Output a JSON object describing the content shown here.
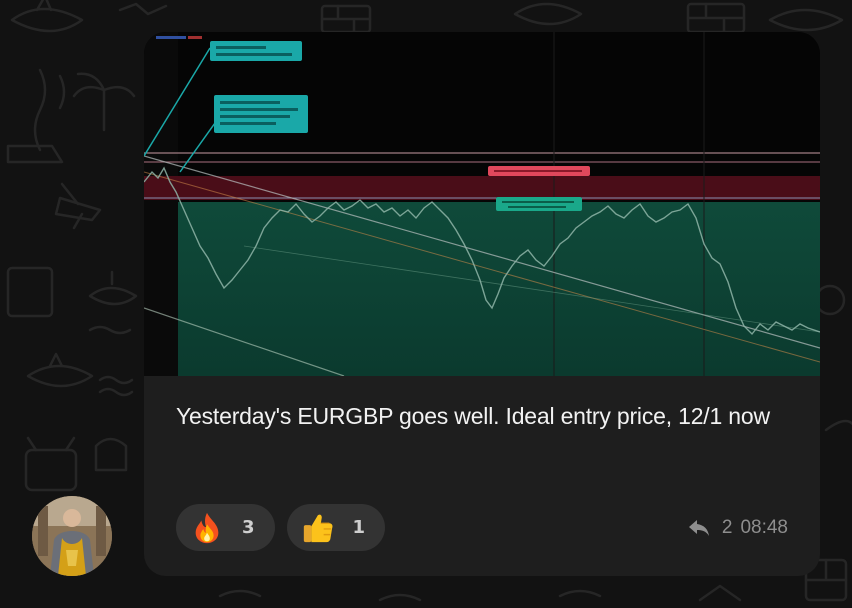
{
  "message": {
    "caption": "Yesterday's EURGBP goes well. Ideal entry price, 12/1 now",
    "reactions": [
      {
        "emoji_icon": "fire-icon",
        "count": "3"
      },
      {
        "emoji_icon": "thumbs-up-icon",
        "count": "1"
      }
    ],
    "reply_icon": "reply-arrow-icon",
    "reply_count": "2",
    "time": "08:48"
  },
  "colors": {
    "background": "#121212",
    "bubble": "#1e1e1e",
    "reaction_pill": "#333333",
    "chart_background": "#050505",
    "chart_zone_green": "#0d3d30",
    "chart_zone_red": "#4a0d18",
    "chart_annotation": "#1aa8a8"
  }
}
